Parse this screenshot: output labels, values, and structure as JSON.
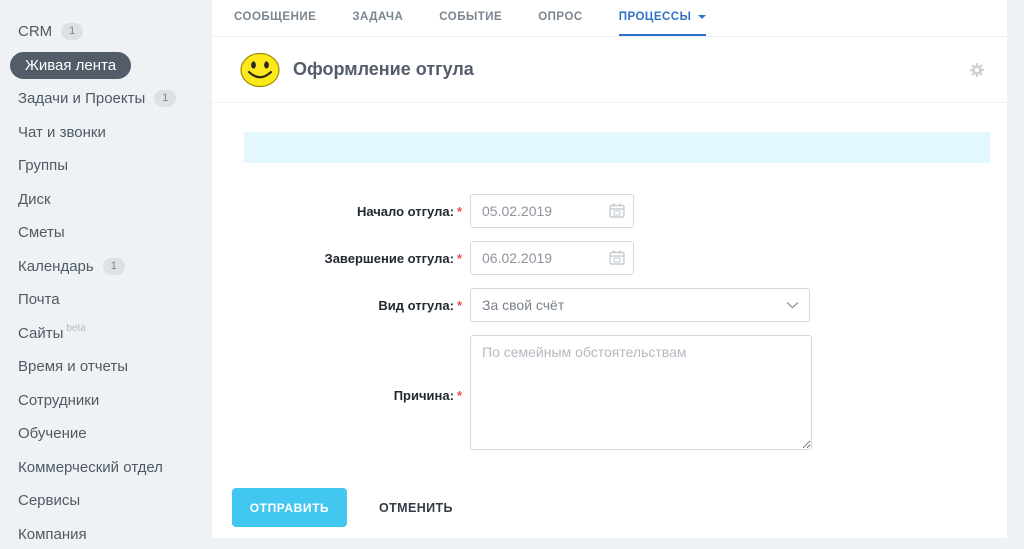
{
  "sidebar": {
    "items": [
      {
        "label": "CRM",
        "badge": "1"
      },
      {
        "label": "Живая лента",
        "active": true
      },
      {
        "label": "Задачи и Проекты",
        "badge": "1"
      },
      {
        "label": "Чат и звонки"
      },
      {
        "label": "Группы"
      },
      {
        "label": "Диск"
      },
      {
        "label": "Сметы"
      },
      {
        "label": "Календарь",
        "badge": "1"
      },
      {
        "label": "Почта"
      },
      {
        "label": "Сайты",
        "suffix": "beta"
      },
      {
        "label": "Время и отчеты"
      },
      {
        "label": "Сотрудники"
      },
      {
        "label": "Обучение"
      },
      {
        "label": "Коммерческий отдел"
      },
      {
        "label": "Сервисы"
      },
      {
        "label": "Компания"
      }
    ]
  },
  "tabs": {
    "items": [
      {
        "label": "СООБЩЕНИЕ"
      },
      {
        "label": "ЗАДАЧА"
      },
      {
        "label": "СОБЫТИЕ"
      },
      {
        "label": "ОПРОС"
      },
      {
        "label": "ПРОЦЕССЫ",
        "active": true,
        "caret_icon": "caret-down-icon"
      }
    ]
  },
  "header": {
    "title": "Оформление отгула",
    "smiley_icon": "smiley-icon",
    "gear_icon": "gear-icon"
  },
  "form": {
    "fields": [
      {
        "label": "Начало отгула:",
        "required": "*",
        "value": "05.02.2019",
        "icon": "calendar-icon"
      },
      {
        "label": "Завершение отгула:",
        "required": "*",
        "value": "06.02.2019",
        "icon": "calendar-icon"
      },
      {
        "label": "Вид отгула:",
        "required": "*",
        "value": "За свой счёт",
        "icon": "chevron-down-icon"
      },
      {
        "label": "Причина:",
        "required": "*",
        "placeholder": "По семейным обстоятельствам"
      }
    ]
  },
  "actions": {
    "submit": "ОТПРАВИТЬ",
    "cancel": "ОТМЕНИТЬ"
  },
  "colors": {
    "accent_blue": "#2e71c6",
    "submit_cyan": "#42c7f1",
    "banner_blue": "#e3f7fe",
    "active_pill": "#535c69",
    "page_bg": "#eef2f4"
  }
}
